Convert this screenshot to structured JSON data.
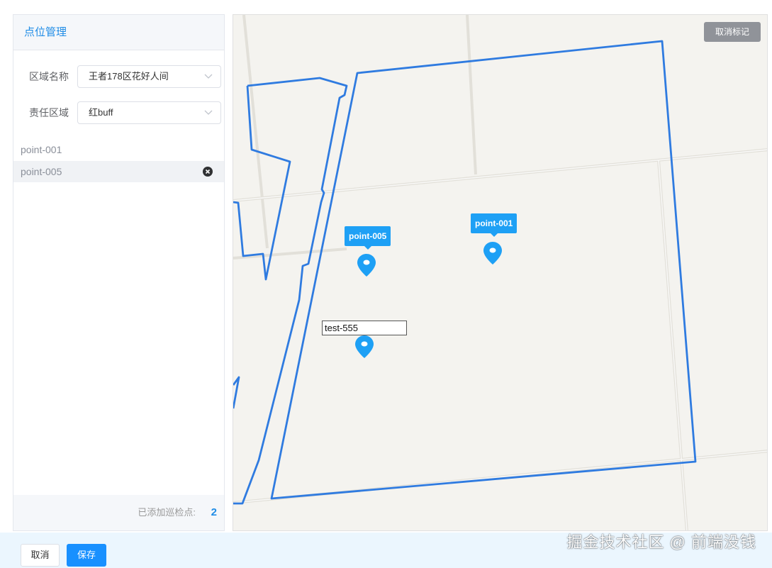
{
  "panel": {
    "title": "点位管理",
    "region_label": "区域名称",
    "region_value": "王者178区花好人间",
    "zone_label": "责任区域",
    "zone_value": "红buff",
    "points": [
      {
        "name": "point-001",
        "active": false
      },
      {
        "name": "point-005",
        "active": true
      }
    ],
    "count_label": "已添加巡检点:",
    "count_value": "2"
  },
  "map": {
    "cancel_mark_label": "取消标记",
    "markers": [
      {
        "label": "point-005"
      },
      {
        "label": "point-001"
      }
    ],
    "new_marker_input_value": "test-555",
    "boundary_color": "#2f7be0",
    "marker_color": "#1ea0f5"
  },
  "footer": {
    "cancel_label": "取消",
    "save_label": "保存"
  },
  "watermark": "掘金技术社区 @ 前端没钱"
}
